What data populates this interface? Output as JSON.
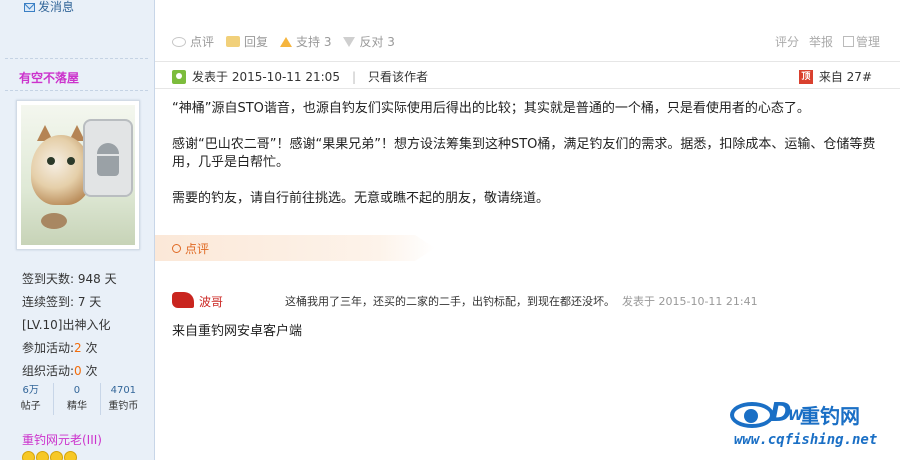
{
  "sidebar": {
    "send_message": "发消息",
    "username": "有空不落屋",
    "stats": [
      {
        "label": "签到天数: ",
        "value": "948 天"
      },
      {
        "label": "连续签到: ",
        "value": "7 天"
      },
      {
        "label": "[LV.10]出神入化",
        "value": ""
      },
      {
        "label": "参加活动:",
        "value": "2",
        "unit": " 次"
      },
      {
        "label": "组织活动:",
        "value": "0",
        "unit": " 次"
      }
    ],
    "counters": [
      {
        "num": "6万",
        "label": "帖子"
      },
      {
        "num": "0",
        "label": "精华"
      },
      {
        "num": "4701",
        "label": "重钓币"
      }
    ],
    "rank": "重钓网元老(III)"
  },
  "actions": {
    "comment": "点评",
    "reply": "回复",
    "support": "支持 3",
    "oppose": "反对 3",
    "rate": "评分",
    "report": "举报",
    "manage": "管理"
  },
  "post": {
    "posted_at": "发表于 2015-10-11 21:05",
    "only_author": "只看该作者",
    "source_badge": "顶",
    "floor": "来自 27#",
    "paragraphs": [
      "“神桶”源自STO谐音，也源自钓友们实际使用后得出的比较；其实就是普通的一个桶，只是看使用者的心态了。",
      "感谢“巴山农二哥”！感谢“果果兄弟”！想方设法筹集到这种STO桶，满足钓友们的需求。据悉，扣除成本、运输、仓储等费用，几乎是白帮忙。",
      "需要的钓友，请自行前往挑选。无意或瞧不起的朋友，敬请绕道。"
    ]
  },
  "comment_section": {
    "label": "点评",
    "author": "波哥",
    "text": "这桶我用了三年，还买的二家的二手，出钓标配，到现在都还没坏。",
    "time": "发表于 2015-10-11 21:41"
  },
  "client_note": "来自重钓网安卓客户端",
  "watermark": {
    "brand": "重钓网",
    "url": "www.cqfishing.net"
  },
  "colors": {
    "accent_orange": "#f26c0b",
    "username_purple": "#cc33cc",
    "link_blue": "#336699",
    "brand_blue": "#1a6fc5"
  }
}
